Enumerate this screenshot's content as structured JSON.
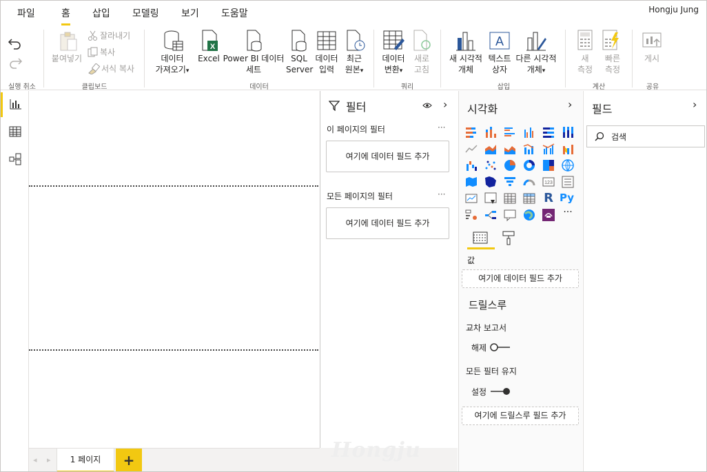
{
  "menu": {
    "tabs": [
      "파일",
      "홈",
      "삽입",
      "모델링",
      "보기",
      "도움말"
    ],
    "active": "홈",
    "user": "Hongju Jung"
  },
  "ribbon": {
    "undo_group": "실행 취소",
    "clipboard": {
      "paste": "붙여넣기",
      "cut": "잘라내기",
      "copy": "복사",
      "format_copy": "서식 복사",
      "group": "클립보드"
    },
    "data": {
      "get_data_1": "데이터",
      "get_data_2": "가져오기",
      "excel": "Excel",
      "pbi_1": "Power BI 데이터",
      "pbi_2": "세트",
      "sql_1": "SQL",
      "sql_2": "Server",
      "enter_1": "데이터",
      "enter_2": "입력",
      "recent_1": "최근",
      "recent_2": "원본",
      "group": "데이터"
    },
    "query": {
      "transform_1": "데이터",
      "transform_2": "변환",
      "refresh_1": "새로",
      "refresh_2": "고침",
      "group": "쿼리"
    },
    "insert": {
      "new_visual_1": "새 시각적",
      "new_visual_2": "개체",
      "textbox_1": "텍스트",
      "textbox_2": "상자",
      "more_visuals_1": "다른 시각적",
      "more_visuals_2": "개체",
      "group": "삽입"
    },
    "calc": {
      "new_measure_1": "새",
      "new_measure_2": "측정",
      "quick_measure_1": "빠른",
      "quick_measure_2": "측정",
      "group": "계산"
    },
    "share": {
      "publish": "게시",
      "group": "공유"
    }
  },
  "page_tabs": {
    "page1": "1 페이지",
    "add": "+"
  },
  "watermark": "Hongju",
  "filters": {
    "title": "필터",
    "this_page": "이 페이지의 필터",
    "all_pages": "모든 페이지의 필터",
    "add_here": "여기에 데이터 필드 추가",
    "more": "···"
  },
  "visualizations": {
    "title": "시각화",
    "values_label": "값",
    "values_well": "여기에 데이터 필드 추가",
    "drillthrough": "드릴스루",
    "cross_report": "교차 보고서",
    "cross_state": "해제",
    "keep_filters": "모든 필터 유지",
    "keep_state": "설정",
    "drill_well": "여기에 드릴스루 필드 추가",
    "more_visuals": "···",
    "r_label": "R",
    "py_label": "Py"
  },
  "fields": {
    "title": "필드",
    "search_placeholder": "검색"
  },
  "colors": {
    "accent": "#f2c811",
    "ribbon_blue": "#2b579a",
    "excel_green": "#217346"
  }
}
